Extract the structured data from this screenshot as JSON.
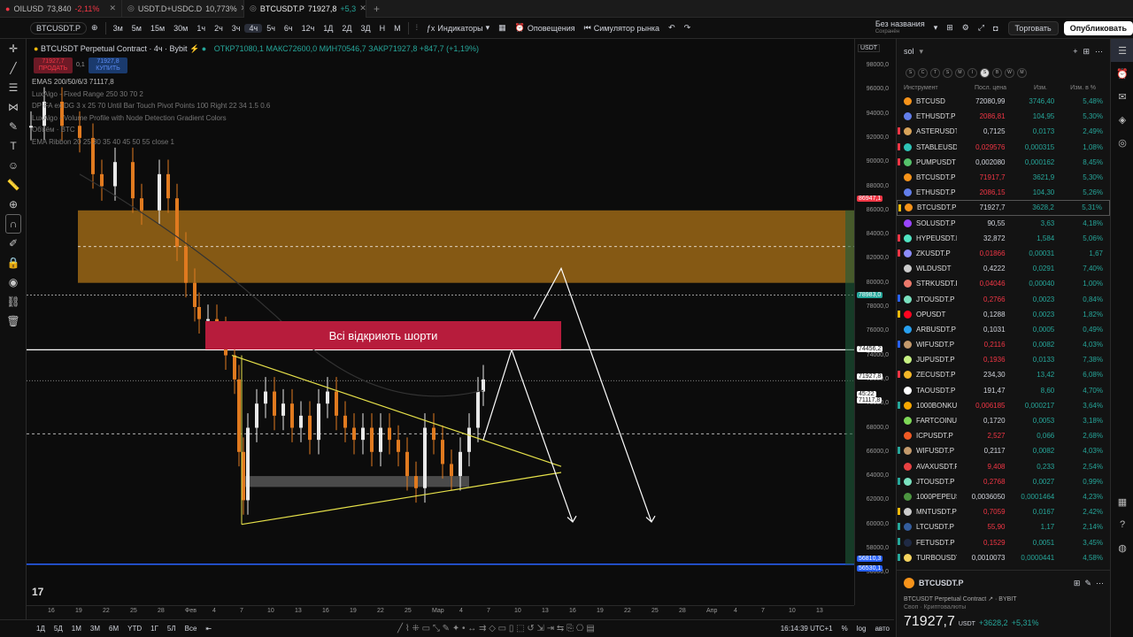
{
  "tabs": [
    {
      "symbol": "OILUSD",
      "price": "73,840",
      "change": "-2,11%"
    },
    {
      "symbol": "USDT.D+USDC.D",
      "price": "10,773%",
      "change": ""
    },
    {
      "symbol": "BTCUSDT.P",
      "price": "71927,8",
      "change": "+5,3"
    }
  ],
  "toolbar": {
    "symbol": "BTCUSDT.P",
    "timeframes": [
      "3м",
      "5м",
      "15м",
      "30м",
      "1ч",
      "2ч",
      "3ч",
      "4ч",
      "5ч",
      "6ч",
      "12ч",
      "1Д",
      "2Д",
      "3Д",
      "Н",
      "М"
    ],
    "active_tf": "4ч",
    "indicators": "Индикаторы",
    "alerts": "Оповещения",
    "simulator": "Симулятор рынка",
    "layout_name": "Без названия",
    "saved": "Сохранён",
    "trade": "Торговать",
    "publish": "Опубликовать"
  },
  "legend": {
    "title": "BTCUSDT Perpetual Contract · 4ч · Bybit",
    "ohlc": "ОТКР71080,1 МАКС72600,0 МИН70546,7 ЗАКР71927,8 +847,7 (+1,19%)",
    "sell_price": "71927,7",
    "sell": "ПРОДАТЬ",
    "spread": "0,1",
    "buy_price": "71927,8",
    "buy": "КУПИТЬ"
  },
  "indicators": [
    "EMAS 200/50/6/3  71117,8",
    "LuxAlgo - Fixed Range 250 30 70 2",
    "DP-FA ex DG  3 x 25 70 Until Bar Touch Pivot Points 100 Right 22 34 1.5 0.6",
    "LuxAlgo - Volume Profile with Node Detection Gradient Colors",
    "Объём · BTC",
    "EMA Ribbon 20 25 30 35 40 45 50 55 close 1"
  ],
  "annotation": "Всі відкриють шорти",
  "price_axis": {
    "currency": "USDT",
    "ticks": [
      "98000,0",
      "96000,0",
      "94000,0",
      "92000,0",
      "90000,0",
      "88000,0",
      "86000,0",
      "84000,0",
      "82000,0",
      "80000,0",
      "78000,0",
      "76000,0",
      "74000,0",
      "72000,0",
      "70000,0",
      "68000,0",
      "66000,0",
      "64000,0",
      "62000,0",
      "60000,0",
      "58000,0",
      "56000,0"
    ],
    "labels": [
      {
        "text": "86947,1",
        "color": "#f23645"
      },
      {
        "text": "78983,0",
        "color": "#26a69a"
      },
      {
        "text": "74456,2",
        "color": "#ffffff"
      },
      {
        "text": "71927,8",
        "color": "#ffffff"
      },
      {
        "text": "45:22",
        "color": "#ffffff"
      },
      {
        "text": "71117,8",
        "color": "#ffffff"
      },
      {
        "text": "56810,3",
        "color": "#2962ff"
      },
      {
        "text": "56530,1",
        "color": "#2962ff"
      }
    ]
  },
  "time_axis": [
    "16",
    "19",
    "22",
    "25",
    "28",
    "Фев",
    "4",
    "7",
    "10",
    "13",
    "16",
    "19",
    "22",
    "25",
    "Мар",
    "4",
    "7",
    "10",
    "13",
    "16",
    "19",
    "22",
    "25",
    "28",
    "Апр",
    "4",
    "7",
    "10",
    "13"
  ],
  "bottom": {
    "ranges": [
      "1Д",
      "5Д",
      "1М",
      "3М",
      "6М",
      "YTD",
      "1Г",
      "5Л",
      "Все"
    ],
    "clock": "16:14:39 UTC+1"
  },
  "watchlist": {
    "name": "sol",
    "letters": [
      "S",
      "C",
      "T",
      "S",
      "M",
      "I",
      "S",
      "B",
      "W",
      "M"
    ],
    "columns": [
      "Инструмент",
      "Посл. цена",
      "Изм.",
      "Изм. в %"
    ],
    "rows": [
      {
        "n": "BTCUSD",
        "p": "72080,99",
        "ch": "3746,40",
        "pc": "5,48%",
        "pr": false,
        "ic": "#f7931a",
        "mk": ""
      },
      {
        "n": "ETHUSDT.P",
        "p": "2086,81",
        "ch": "104,95",
        "pc": "5,30%",
        "pr": true,
        "ic": "#627eea",
        "mk": ""
      },
      {
        "n": "ASTERUSDT",
        "p": "0,7125",
        "ch": "0,0173",
        "pc": "2,49%",
        "pr": false,
        "ic": "#d9a45a",
        "mk": "#f23645"
      },
      {
        "n": "STABLEUSDT",
        "p": "0,029576",
        "ch": "0,000315",
        "pc": "1,08%",
        "pr": true,
        "ic": "#2ec4b6",
        "mk": "#f23645"
      },
      {
        "n": "PUMPUSDT",
        "p": "0,002080",
        "ch": "0,000162",
        "pc": "8,45%",
        "pr": false,
        "ic": "#55c26b",
        "mk": "#f23645"
      },
      {
        "n": "BTCUSDT.P",
        "p": "71917,7",
        "ch": "3621,9",
        "pc": "5,30%",
        "pr": true,
        "ic": "#f7931a",
        "mk": ""
      },
      {
        "n": "ETHUSDT.P",
        "p": "2086,15",
        "ch": "104,30",
        "pc": "5,26%",
        "pr": true,
        "ic": "#627eea",
        "mk": ""
      },
      {
        "n": "BTCUSDT.P",
        "p": "71927,7",
        "ch": "3628,2",
        "pc": "5,31%",
        "pr": false,
        "ic": "#f7931a",
        "mk": "#f0b90b",
        "sel": true
      },
      {
        "n": "SOLUSDT.P",
        "p": "90,55",
        "ch": "3,63",
        "pc": "4,18%",
        "pr": false,
        "ic": "#9945ff",
        "mk": ""
      },
      {
        "n": "HYPEUSDT.P",
        "p": "32,872",
        "ch": "1,584",
        "pc": "5,06%",
        "pr": false,
        "ic": "#50e3c2",
        "mk": "#f23645"
      },
      {
        "n": "ZKUSDT.P",
        "p": "0,01866",
        "ch": "0,00031",
        "pc": "1,67",
        "pr": true,
        "ic": "#8c8dfc",
        "mk": "#f23645"
      },
      {
        "n": "WLDUSDT",
        "p": "0,4222",
        "ch": "0,0291",
        "pc": "7,40%",
        "pr": false,
        "ic": "#cccccc",
        "mk": ""
      },
      {
        "n": "STRKUSDT.P",
        "p": "0,04046",
        "ch": "0,00040",
        "pc": "1,00%",
        "pr": true,
        "ic": "#ec796b",
        "mk": ""
      },
      {
        "n": "JTOUSDT.P",
        "p": "0,2766",
        "ch": "0,0023",
        "pc": "0,84%",
        "pr": true,
        "ic": "#7ae1bf",
        "mk": "#2962ff"
      },
      {
        "n": "OPUSDT",
        "p": "0,1288",
        "ch": "0,0023",
        "pc": "1,82%",
        "pr": false,
        "ic": "#ff0420",
        "mk": "#f0b90b"
      },
      {
        "n": "ARBUSDT.P",
        "p": "0,1031",
        "ch": "0,0005",
        "pc": "0,49%",
        "pr": false,
        "ic": "#28a0f0",
        "mk": ""
      },
      {
        "n": "WIFUSDT.P",
        "p": "0,2116",
        "ch": "0,0082",
        "pc": "4,03%",
        "pr": true,
        "ic": "#c49a6c",
        "mk": "#2962ff"
      },
      {
        "n": "JUPUSDT.P",
        "p": "0,1936",
        "ch": "0,0133",
        "pc": "7,38%",
        "pr": true,
        "ic": "#c7f284",
        "mk": ""
      },
      {
        "n": "ZECUSDT.P",
        "p": "234,30",
        "ch": "13,42",
        "pc": "6,08%",
        "pr": false,
        "ic": "#f4b728",
        "mk": "#f23645"
      },
      {
        "n": "TAOUSDT.P",
        "p": "191,47",
        "ch": "8,60",
        "pc": "4,70%",
        "pr": false,
        "ic": "#ffffff",
        "mk": ""
      },
      {
        "n": "1000BONKUSDT",
        "p": "0,006185",
        "ch": "0,000217",
        "pc": "3,64%",
        "pr": true,
        "ic": "#f8a700",
        "mk": "#26a69a"
      },
      {
        "n": "FARTCOINUSDT",
        "p": "0,1720",
        "ch": "0,0053",
        "pc": "3,18%",
        "pr": false,
        "ic": "#7ed957",
        "mk": ""
      },
      {
        "n": "ICPUSDT.P",
        "p": "2,527",
        "ch": "0,066",
        "pc": "2,68%",
        "pr": true,
        "ic": "#f15a24",
        "mk": ""
      },
      {
        "n": "WIFUSDT.P",
        "p": "0,2117",
        "ch": "0,0082",
        "pc": "4,03%",
        "pr": false,
        "ic": "#c49a6c",
        "mk": "#26a69a"
      },
      {
        "n": "AVAXUSDT.P",
        "p": "9,408",
        "ch": "0,233",
        "pc": "2,54%",
        "pr": true,
        "ic": "#e84142",
        "mk": ""
      },
      {
        "n": "JTOUSDT.P",
        "p": "0,2768",
        "ch": "0,0027",
        "pc": "0,99%",
        "pr": true,
        "ic": "#7ae1bf",
        "mk": "#26a69a"
      },
      {
        "n": "1000PEPEUSDT",
        "p": "0,0036050",
        "ch": "0,0001464",
        "pc": "4,23%",
        "pr": false,
        "ic": "#4c9540",
        "mk": ""
      },
      {
        "n": "MNTUSDT.P",
        "p": "0,7059",
        "ch": "0,0167",
        "pc": "2,42%",
        "pr": true,
        "ic": "#cccccc",
        "mk": "#f0b90b"
      },
      {
        "n": "LTCUSDT.P",
        "p": "55,90",
        "ch": "1,17",
        "pc": "2,14%",
        "pr": true,
        "ic": "#345d9d",
        "mk": "#26a69a"
      },
      {
        "n": "FETUSDT.P",
        "p": "0,1529",
        "ch": "0,0051",
        "pc": "3,45%",
        "pr": true,
        "ic": "#1f2a44",
        "mk": "#26a69a"
      },
      {
        "n": "TURBOUSDT",
        "p": "0,0010073",
        "ch": "0,0000441",
        "pc": "4,58%",
        "pr": false,
        "ic": "#f4d35e",
        "mk": "#26a69a"
      }
    ]
  },
  "detail": {
    "symbol": "BTCUSDT.P",
    "desc": "BTCUSDT Perpetual Contract",
    "exchange": "BYBIT",
    "category": "Своп · Криптовалюты",
    "price": "71927,7",
    "currency": "USDT",
    "change": "+3628,2",
    "change_pct": "+5,31%"
  }
}
